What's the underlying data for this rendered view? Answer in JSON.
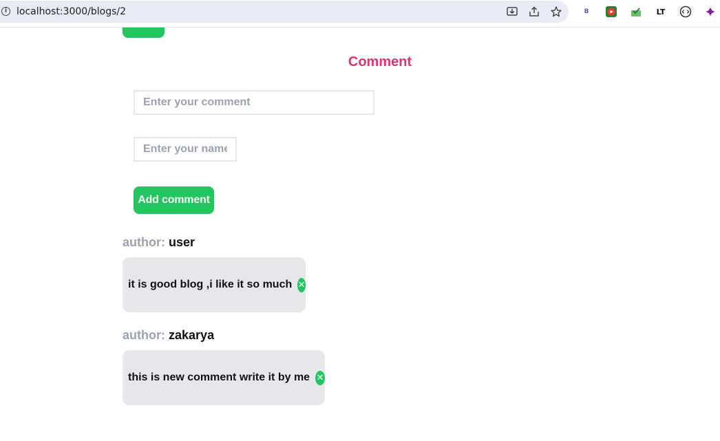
{
  "browser": {
    "url": "localhost:3000/blogs/2",
    "icons": [
      "info-icon",
      "install-icon",
      "share-icon",
      "bookmark-star-icon"
    ],
    "extensions": [
      "bitwarden-extension-icon",
      "video-extension-icon",
      "mail-extension-icon",
      "languagetool-extension-icon",
      "code-extension-icon",
      "sparkle-extension-icon"
    ]
  },
  "page": {
    "section_title": "Comment",
    "comment_placeholder": "Enter your comment",
    "name_placeholder": "Enter your name",
    "add_button_label": "Add comment",
    "author_key": "author:",
    "delete_glyph": "✕"
  },
  "comments": [
    {
      "author": "user",
      "text": "it is good blog ,i like it so much"
    },
    {
      "author": "zakarya",
      "text": "this is new comment write it by me"
    }
  ],
  "colors": {
    "accent_green": "#22c55e",
    "title_pink": "#e0356b",
    "muted_gray": "#9ca3af",
    "card_bg": "#e5e7eb"
  }
}
